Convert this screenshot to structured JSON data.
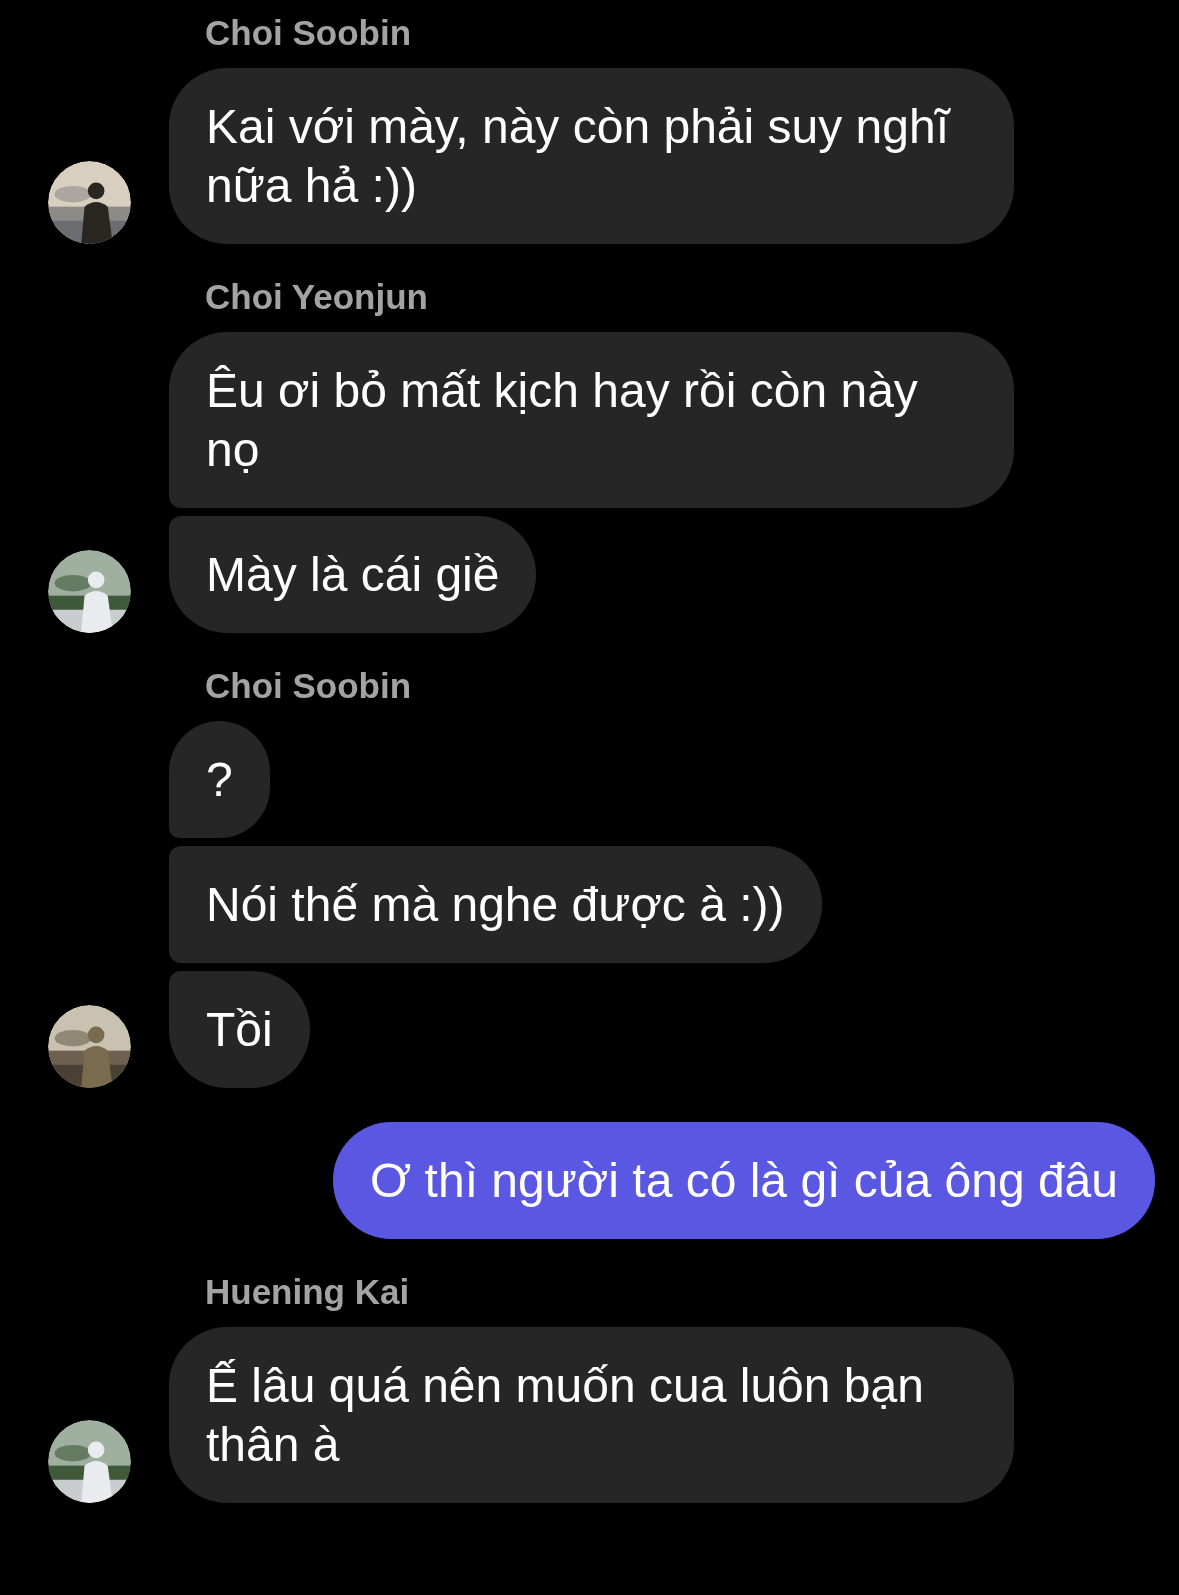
{
  "groups": [
    {
      "kind": "incoming",
      "sender": "Choi Soobin",
      "avatar": {
        "kind": "picture"
      },
      "messages": [
        "Kai với mày, này còn phải suy nghĩ nữa hả :))"
      ]
    },
    {
      "kind": "incoming",
      "sender": "Choi Yeonjun",
      "avatar": {
        "kind": "picture"
      },
      "messages": [
        "Êu ơi bỏ mất kịch hay rồi còn này nọ",
        "Mày là cái giề"
      ]
    },
    {
      "kind": "incoming",
      "sender": "Choi Soobin",
      "avatar": {
        "kind": "picture"
      },
      "messages": [
        "?",
        "Nói thế mà nghe được à :))",
        "Tồi"
      ]
    },
    {
      "kind": "outgoing",
      "messages": [
        "Ơ thì người ta có là gì của ông đâu"
      ]
    },
    {
      "kind": "incoming",
      "sender": "Huening Kai",
      "avatar": {
        "kind": "picture"
      },
      "messages": [
        "Ế lâu quá nên muốn cua luôn bạn thân à"
      ]
    }
  ]
}
